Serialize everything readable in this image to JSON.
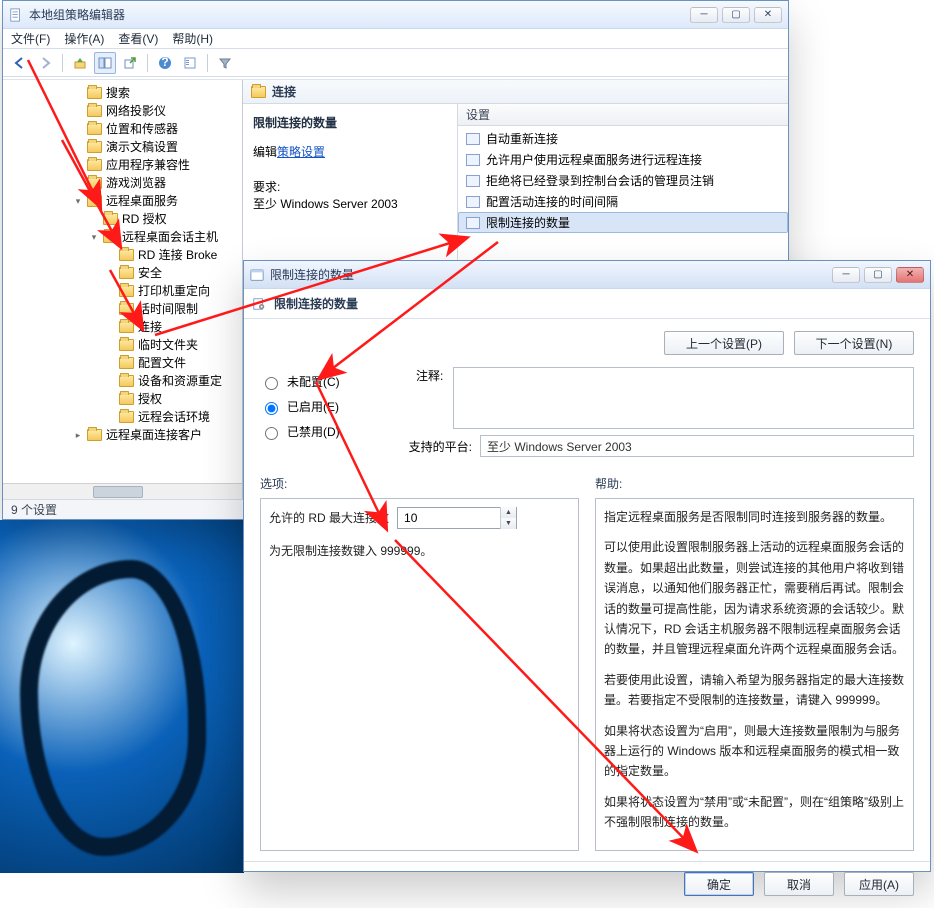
{
  "editor": {
    "title": "本地组策略编辑器",
    "menu": {
      "file": "文件(F)",
      "action": "操作(A)",
      "view": "查看(V)",
      "help": "帮助(H)"
    },
    "tree": {
      "items": [
        {
          "label": "搜索"
        },
        {
          "label": "网络投影仪"
        },
        {
          "label": "位置和传感器"
        },
        {
          "label": "演示文稿设置"
        },
        {
          "label": "应用程序兼容性"
        },
        {
          "label": "游戏浏览器"
        },
        {
          "label": "远程桌面服务",
          "expanded": true,
          "children": [
            {
              "label": "RD 授权"
            },
            {
              "label": "远程桌面会话主机",
              "expanded": true,
              "children": [
                {
                  "label": "RD 连接 Broke"
                },
                {
                  "label": "安全"
                },
                {
                  "label": "打印机重定向"
                },
                {
                  "label": "话时间限制"
                },
                {
                  "label": "连接"
                },
                {
                  "label": "临时文件夹"
                },
                {
                  "label": "配置文件"
                },
                {
                  "label": "设备和资源重定"
                },
                {
                  "label": "授权"
                },
                {
                  "label": "远程会话环境"
                }
              ]
            }
          ]
        },
        {
          "label": "远程桌面连接客户"
        }
      ]
    },
    "detail": {
      "header_icon_folder": "连接",
      "heading": "限制连接的数量",
      "edit_label": "编辑",
      "edit_link": "策略设置",
      "req_label": "要求:",
      "req_value": "至少 Windows Server 2003"
    },
    "list": {
      "column": "设置",
      "items": [
        "自动重新连接",
        "允许用户使用远程桌面服务进行远程连接",
        "拒绝将已经登录到控制台会话的管理员注销",
        "配置活动连接的时间间隔",
        "限制连接的数量"
      ],
      "selected_index": 4
    },
    "status": "9 个设置"
  },
  "dialog": {
    "title": "限制连接的数量",
    "subtitle": "限制连接的数量",
    "nav": {
      "prev": "上一个设置(P)",
      "next": "下一个设置(N)"
    },
    "radios": {
      "not_configured": "未配置(C)",
      "enabled": "已启用(E)",
      "disabled": "已禁用(D)",
      "selected": "enabled"
    },
    "comment_label": "注释:",
    "platform_label": "支持的平台:",
    "platform_value": "至少 Windows Server 2003",
    "options_label": "选项:",
    "help_label": "帮助:",
    "option": {
      "label": "允许的 RD 最大连接数",
      "value": "10",
      "hint": "为无限制连接数键入 999999。"
    },
    "help_text": "指定远程桌面服务是否限制同时连接到服务器的数量。\n\n可以使用此设置限制服务器上活动的远程桌面服务会话的数量。如果超出此数量，则尝试连接的其他用户将收到错误消息，以通知他们服务器正忙，需要稍后再试。限制会话的数量可提高性能，因为请求系统资源的会话较少。默认情况下，RD 会话主机服务器不限制远程桌面服务会话的数量，并且管理远程桌面允许两个远程桌面服务会话。\n\n若要使用此设置，请输入希望为服务器指定的最大连接数量。若要指定不受限制的连接数量，请键入 999999。\n\n如果将状态设置为“启用”，则最大连接数量限制为与服务器上运行的 Windows 版本和远程桌面服务的模式相一致的指定数量。\n\n如果将状态设置为“禁用”或“未配置”，则在“组策略”级别上不强制限制连接的数量。",
    "buttons": {
      "ok": "确定",
      "cancel": "取消",
      "apply": "应用(A)"
    }
  }
}
